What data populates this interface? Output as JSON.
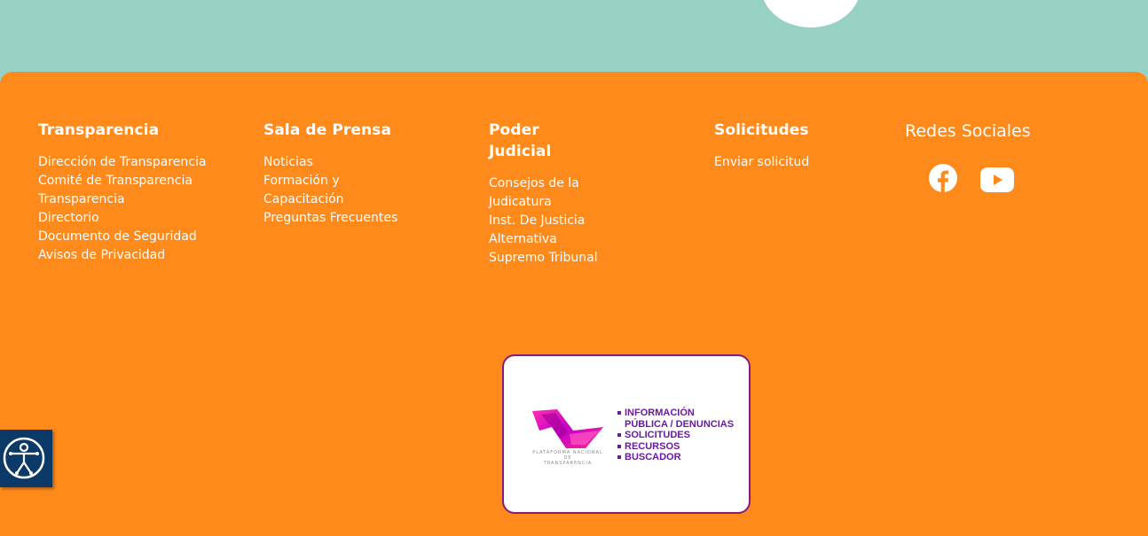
{
  "colors": {
    "teal": "#97d1c3",
    "orange": "#ff8a1c",
    "navy": "#0b3a68",
    "purple": "#6a1aa0",
    "magenta": "#8a1a7a"
  },
  "footer": {
    "columns": [
      {
        "title": "Transparencia",
        "items": [
          "Dirección de Transparencia",
          "Comité de Transparencia",
          "Transparencia",
          "Directorio",
          "Documento de Seguridad",
          "Avisos de Privacidad"
        ]
      },
      {
        "title": "Sala de Prensa",
        "items": [
          "Noticias",
          "Formación y Capacitación",
          "Preguntas Frecuentes"
        ]
      },
      {
        "title": "Poder Judicial",
        "items": [
          "Consejos de la Judicatura",
          "Inst. De Justicia Alternativa",
          "Supremo Tribunal"
        ]
      },
      {
        "title": "Solicitudes",
        "items": [
          "Enviar solicitud"
        ]
      }
    ],
    "social": {
      "title": "Redes Sociales",
      "icons": [
        "facebook-icon",
        "youtube-icon"
      ]
    }
  },
  "pnt_banner": {
    "logo_caption_1": "PLATAFORMA NACIONAL DE",
    "logo_caption_2": "TRANSPARENCIA",
    "menu": [
      "INFORMACIÓN",
      "PÚBLICA / DENUNCIAS",
      "SOLICITUDES",
      "RECURSOS",
      "BUSCADOR"
    ]
  },
  "accessibility": {
    "icon": "accessibility-icon"
  }
}
